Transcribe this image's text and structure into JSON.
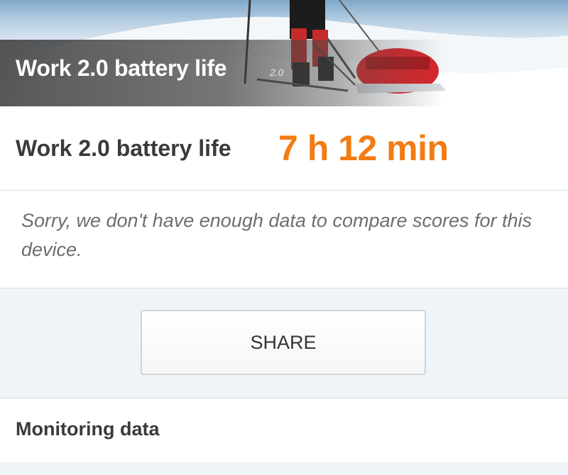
{
  "banner": {
    "title": "Work 2.0 battery life",
    "version": "2.0"
  },
  "score": {
    "label": "Work 2.0 battery life",
    "value": "7 h 12 min",
    "accent_color": "#f27c14"
  },
  "message": {
    "text": "Sorry, we don't have enough data to compare scores for this device."
  },
  "share": {
    "label": "SHARE"
  },
  "monitoring": {
    "label": "Monitoring data"
  }
}
